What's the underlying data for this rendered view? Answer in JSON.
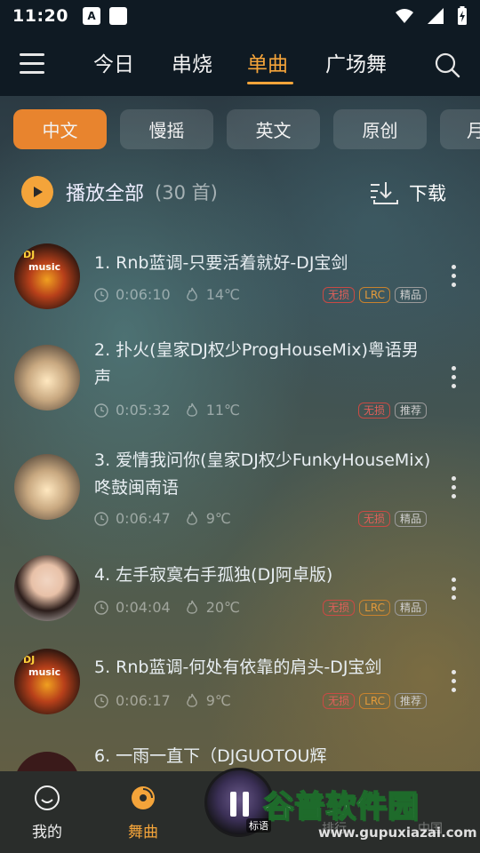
{
  "status_bar": {
    "time": "11:20",
    "app_icon_letter": "A"
  },
  "top_nav": {
    "tabs": [
      "今日",
      "串烧",
      "单曲",
      "广场舞"
    ],
    "active_tab": "单曲"
  },
  "categories": {
    "items": [
      "中文",
      "慢摇",
      "英文",
      "原创",
      "月"
    ],
    "active": "中文"
  },
  "toolbar": {
    "play_all_label": "播放全部",
    "count_label": "(30 首)",
    "download_label": "下载"
  },
  "songs": [
    {
      "title": "1. Rnb蓝调-只要活着就好-DJ宝剑",
      "duration": "0:06:10",
      "heat": "14℃",
      "badges": [
        "无损",
        "LRC",
        "精品"
      ],
      "cover": "dj"
    },
    {
      "title": "2. 扑火(皇家DJ权少ProgHouseMix)粤语男声",
      "duration": "0:05:32",
      "heat": "11℃",
      "badges": [
        "无损",
        "推荐"
      ],
      "cover": "car"
    },
    {
      "title": "3. 爱情我问你(皇家DJ权少FunkyHouseMix)咚鼓闽南语",
      "duration": "0:06:47",
      "heat": "9℃",
      "badges": [
        "无损",
        "精品"
      ],
      "cover": "car"
    },
    {
      "title": "4. 左手寂寞右手孤独(DJ阿卓版)",
      "duration": "0:04:04",
      "heat": "20℃",
      "badges": [
        "无损",
        "LRC",
        "精品"
      ],
      "cover": "woman"
    },
    {
      "title": "5. Rnb蓝调-何处有依靠的肩头-DJ宝剑",
      "duration": "0:06:17",
      "heat": "9℃",
      "badges": [
        "无损",
        "LRC",
        "推荐"
      ],
      "cover": "dj"
    },
    {
      "title": "6. 一雨一直下（DJGUOTOU辉"
    }
  ],
  "cover_dj_text": {
    "line1": "DJ",
    "line2": "music"
  },
  "bottom_nav": {
    "items": [
      "我的",
      "舞曲"
    ],
    "active": "舞曲",
    "mini_player_label": "标语",
    "ghost_labels": [
      "排行",
      "中国"
    ]
  },
  "watermark": {
    "title": "谷普软件园",
    "url": "www.gupuxiazai.com"
  },
  "colors": {
    "accent": "#f4a43a",
    "active_chip": "#e8842e",
    "lossless": "#e0605a",
    "lrc": "#e39a3a"
  }
}
